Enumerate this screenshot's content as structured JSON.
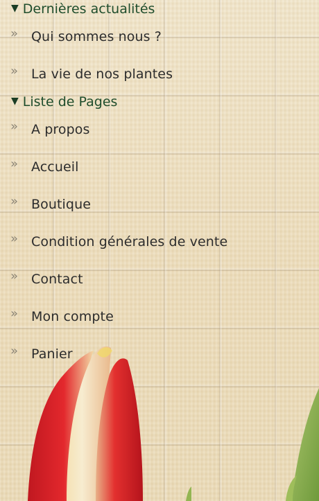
{
  "widgets": {
    "news": {
      "heading": "Dernières actualités",
      "items": [
        {
          "label": "Qui sommes nous ?"
        },
        {
          "label": "La vie de nos plantes"
        }
      ]
    },
    "pages": {
      "heading": "Liste de Pages",
      "items": [
        {
          "label": "A propos"
        },
        {
          "label": "Accueil"
        },
        {
          "label": "Boutique"
        },
        {
          "label": "Condition générales de vente"
        },
        {
          "label": "Contact"
        },
        {
          "label": "Mon compte"
        },
        {
          "label": "Panier"
        }
      ]
    }
  },
  "icons": {
    "caret": "▼",
    "chevron": "»"
  },
  "colors": {
    "heading_text": "#1f4d2c",
    "item_text": "#2c2c2c",
    "chevron": "#8b8475",
    "background": "#efe3c6",
    "tulip_red": "#d8262b",
    "tulip_cream": "#f3e6c4",
    "leaf_green": "#8ab04f"
  }
}
